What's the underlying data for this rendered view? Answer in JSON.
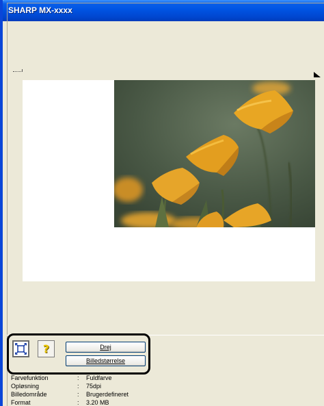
{
  "window": {
    "title": "SHARP MX-xxxx"
  },
  "toolbar": {
    "fit_icon": "fit-to-window-icon",
    "help_icon": "question-mark-icon",
    "help_glyph": "?",
    "rotate_label": "Drej",
    "image_size_label": "Billedstørrelse"
  },
  "info": {
    "rows": [
      {
        "label": "Farvefunktion",
        "sep": ":",
        "value": "Fuldfarve"
      },
      {
        "label": "Opløsning",
        "sep": ":",
        "value": "75dpi"
      },
      {
        "label": "Billedområde",
        "sep": ":",
        "value": "Brugerdefineret"
      },
      {
        "label": "Format",
        "sep": ":",
        "value": "3.20 MB"
      }
    ]
  },
  "colors": {
    "titlebar": "#0054e3",
    "face": "#ece9d8",
    "highlight": "#000000"
  }
}
